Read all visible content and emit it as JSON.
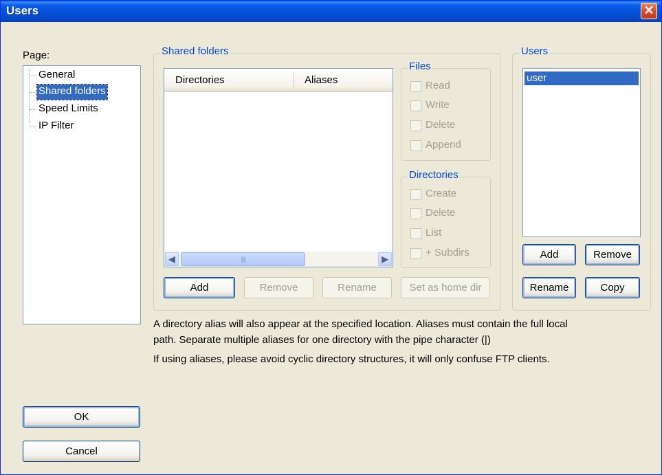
{
  "window": {
    "title": "Users",
    "close_glyph": "✕"
  },
  "page_label": "Page:",
  "tree": {
    "items": [
      {
        "label": "General",
        "selected": false
      },
      {
        "label": "Shared folders",
        "selected": true
      },
      {
        "label": "Speed Limits",
        "selected": false
      },
      {
        "label": "IP Filter",
        "selected": false
      }
    ]
  },
  "shared_folders": {
    "title": "Shared folders",
    "columns": [
      "Directories",
      "Aliases"
    ],
    "rows": [],
    "buttons": {
      "add": "Add",
      "remove": "Remove",
      "rename": "Rename",
      "set_home": "Set as home dir"
    }
  },
  "files": {
    "title": "Files",
    "options": [
      "Read",
      "Write",
      "Delete",
      "Append"
    ]
  },
  "directories": {
    "title": "Directories",
    "options": [
      "Create",
      "Delete",
      "List",
      "+ Subdirs"
    ]
  },
  "users": {
    "title": "Users",
    "items": [
      "user"
    ],
    "buttons": {
      "add": "Add",
      "remove": "Remove",
      "rename": "Rename",
      "copy": "Copy"
    }
  },
  "info": {
    "line1": "A directory alias will also appear at the specified location. Aliases must contain the full local",
    "line2": "path. Separate multiple aliases for one directory with the pipe character (|)",
    "line3": "If using aliases, please avoid cyclic directory structures, it will only confuse FTP clients."
  },
  "dialog_buttons": {
    "ok": "OK",
    "cancel": "Cancel"
  },
  "colors": {
    "title_bar": "#0054e3",
    "selection": "#316ac5",
    "group_title": "#0046d5",
    "close_button": "#d8532f"
  },
  "icons": {
    "scroll_left": "chevron-left-icon",
    "scroll_right": "chevron-right-icon",
    "scroll_grip": "grip-icon"
  }
}
